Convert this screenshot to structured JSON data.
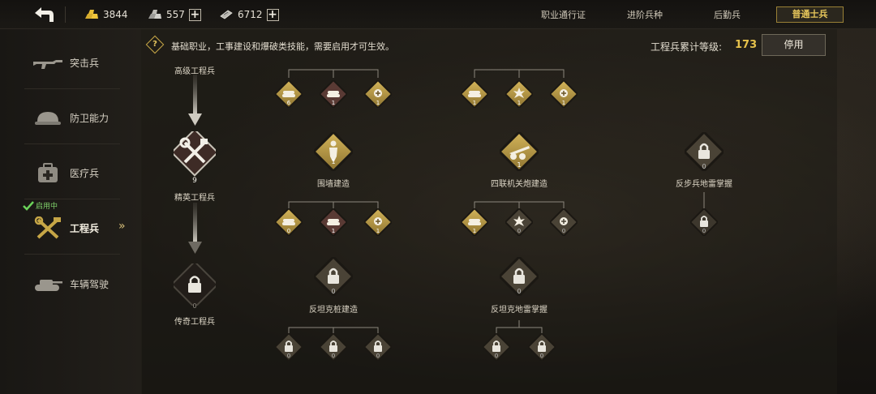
{
  "topbar": {
    "gold": "3844",
    "silver": "557",
    "tickets": "6712",
    "tabs": [
      "职业通行证",
      "进阶兵种",
      "后勤兵"
    ],
    "active_tab": "普通士兵"
  },
  "sidebar": {
    "items": [
      {
        "label": "突击兵",
        "icon": "rifle-icon"
      },
      {
        "label": "防卫能力",
        "icon": "helmet-icon"
      },
      {
        "label": "医疗兵",
        "icon": "medkit-icon"
      },
      {
        "label": "工程兵",
        "icon": "tools-icon"
      },
      {
        "label": "车辆驾驶",
        "icon": "tank-icon"
      }
    ],
    "active_flag": "启用中"
  },
  "info": {
    "description": "基础职业，工事建设和爆破类技能，需要启用才可生效。",
    "level_label": "工程兵累计等级:",
    "level_value": "173",
    "disable_button": "停用"
  },
  "tree": {
    "ranks": [
      {
        "label": "高级工程兵"
      },
      {
        "label": "精英工程兵",
        "level": "9"
      },
      {
        "label": "传奇工程兵",
        "level": "0"
      }
    ],
    "skills": [
      {
        "label": "围墙建造",
        "level": "1"
      },
      {
        "label": "四联机关炮建造",
        "level": "1"
      },
      {
        "label": "反步兵地雷掌握",
        "level": "0"
      },
      {
        "label": "反坦克桩建造",
        "level": "0"
      },
      {
        "label": "反坦克地雷掌握",
        "level": "0"
      }
    ],
    "subs_top_left": [
      "6",
      "1",
      "1"
    ],
    "subs_top_mid": [
      "1",
      "1",
      "1"
    ],
    "subs_row2_left": [
      "0",
      "1",
      "1"
    ],
    "subs_row2_mid": [
      "1",
      "0",
      "0"
    ],
    "sub_row2_right": "0",
    "subs_row3_left": [
      "0",
      "0",
      "0"
    ],
    "subs_row3_mid": [
      "0",
      "0"
    ]
  },
  "colors": {
    "gold_accent": "#e6c24b",
    "active_green": "#7fd16a",
    "node_gold": "#c6a646"
  }
}
